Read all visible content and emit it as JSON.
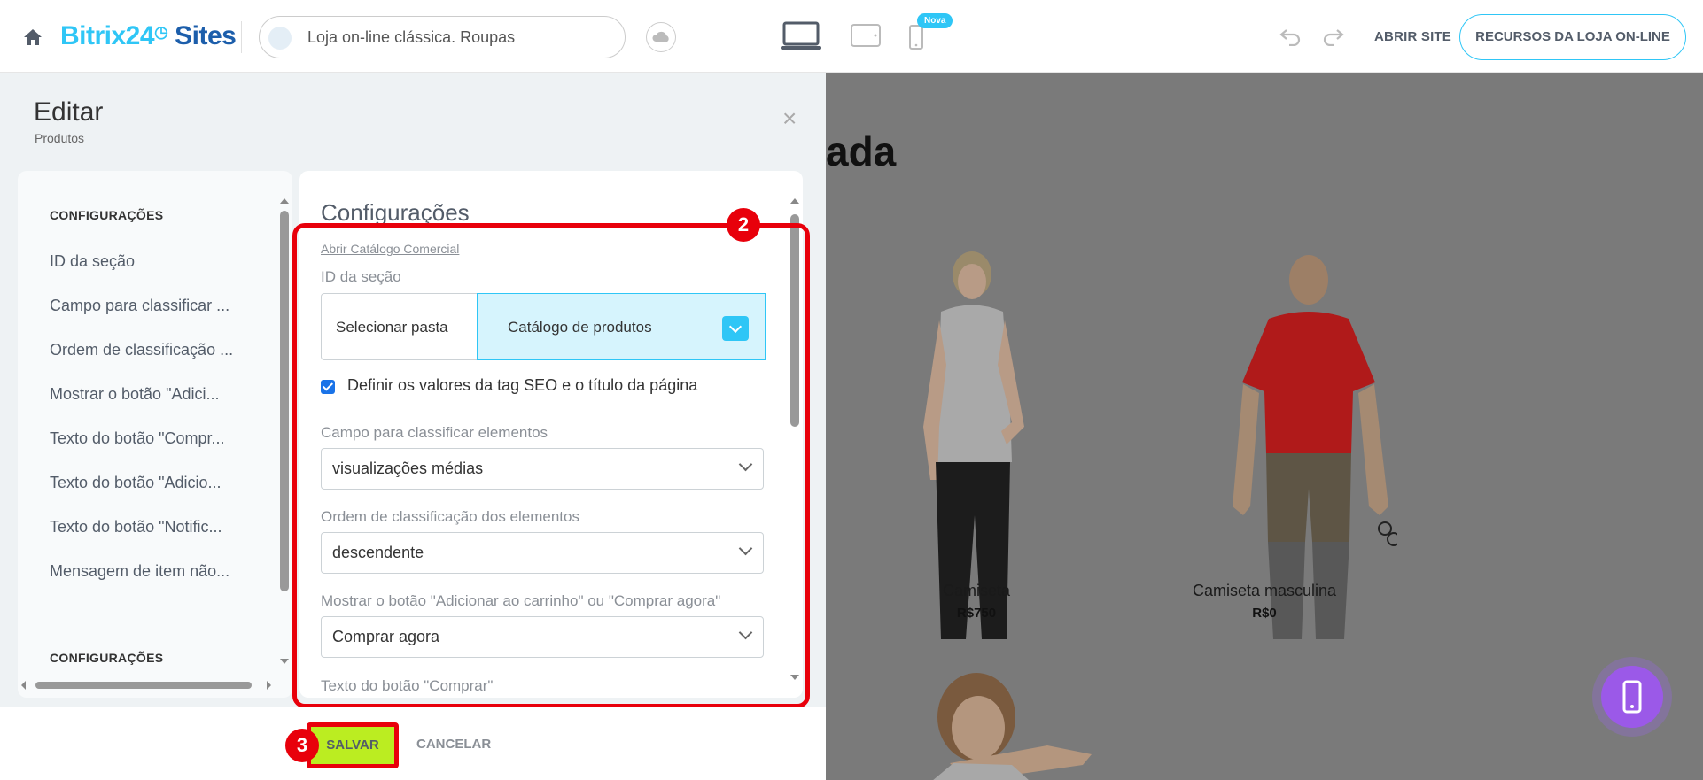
{
  "topbar": {
    "brand_part1": "Bitrix24",
    "brand_part2": "Sites",
    "site_name": "Loja on-line clássica. Roupas",
    "badge_new": "Nova",
    "open_site": "ABRIR SITE",
    "store_resources": "RECURSOS DA LOJA ON-LINE"
  },
  "editor": {
    "title": "Editar",
    "subtitle": "Produtos",
    "close": "×"
  },
  "left_nav": {
    "section_header": "CONFIGURAÇÕES",
    "items": [
      "ID da seção",
      "Campo para classificar ...",
      "Ordem de classificação ...",
      "Mostrar o botão \"Adici...",
      "Texto do botão \"Compr...",
      "Texto do botão \"Adicio...",
      "Texto do botão \"Notific...",
      "Mensagem de item não..."
    ],
    "section_header_2": "CONFIGURAÇÕES"
  },
  "settings": {
    "title": "Configurações",
    "open_catalog_link": "Abrir Catálogo Comercial",
    "section_id_label": "ID da seção",
    "select_folder": "Selecionar pasta",
    "folder_value": "Catálogo de produtos",
    "seo_checkbox_label": "Definir os valores da tag SEO e o título da página",
    "seo_checked": true,
    "sort_field_label": "Campo para classificar elementos",
    "sort_field_value": "visualizações médias",
    "sort_order_label": "Ordem de classificação dos elementos",
    "sort_order_value": "descendente",
    "show_button_label": "Mostrar o botão \"Adicionar ao carrinho\" ou \"Comprar agora\"",
    "show_button_value": "Comprar agora",
    "buy_text_label": "Texto do botão \"Comprar\""
  },
  "footer": {
    "save": "SALVAR",
    "cancel": "CANCELAR"
  },
  "annotations": {
    "step2": "2",
    "step3": "3"
  },
  "preview": {
    "heading_fragment": "ada",
    "products": [
      {
        "name": "Camiseta",
        "price": "R$750"
      },
      {
        "name": "Camiseta masculina",
        "price": "R$0"
      }
    ]
  },
  "colors": {
    "accent": "#2fc6f6",
    "brand_dark": "#1c5eab",
    "save_button": "#bbed21",
    "annotation_red": "#e8000b",
    "overlay": "#7a7a7a"
  }
}
